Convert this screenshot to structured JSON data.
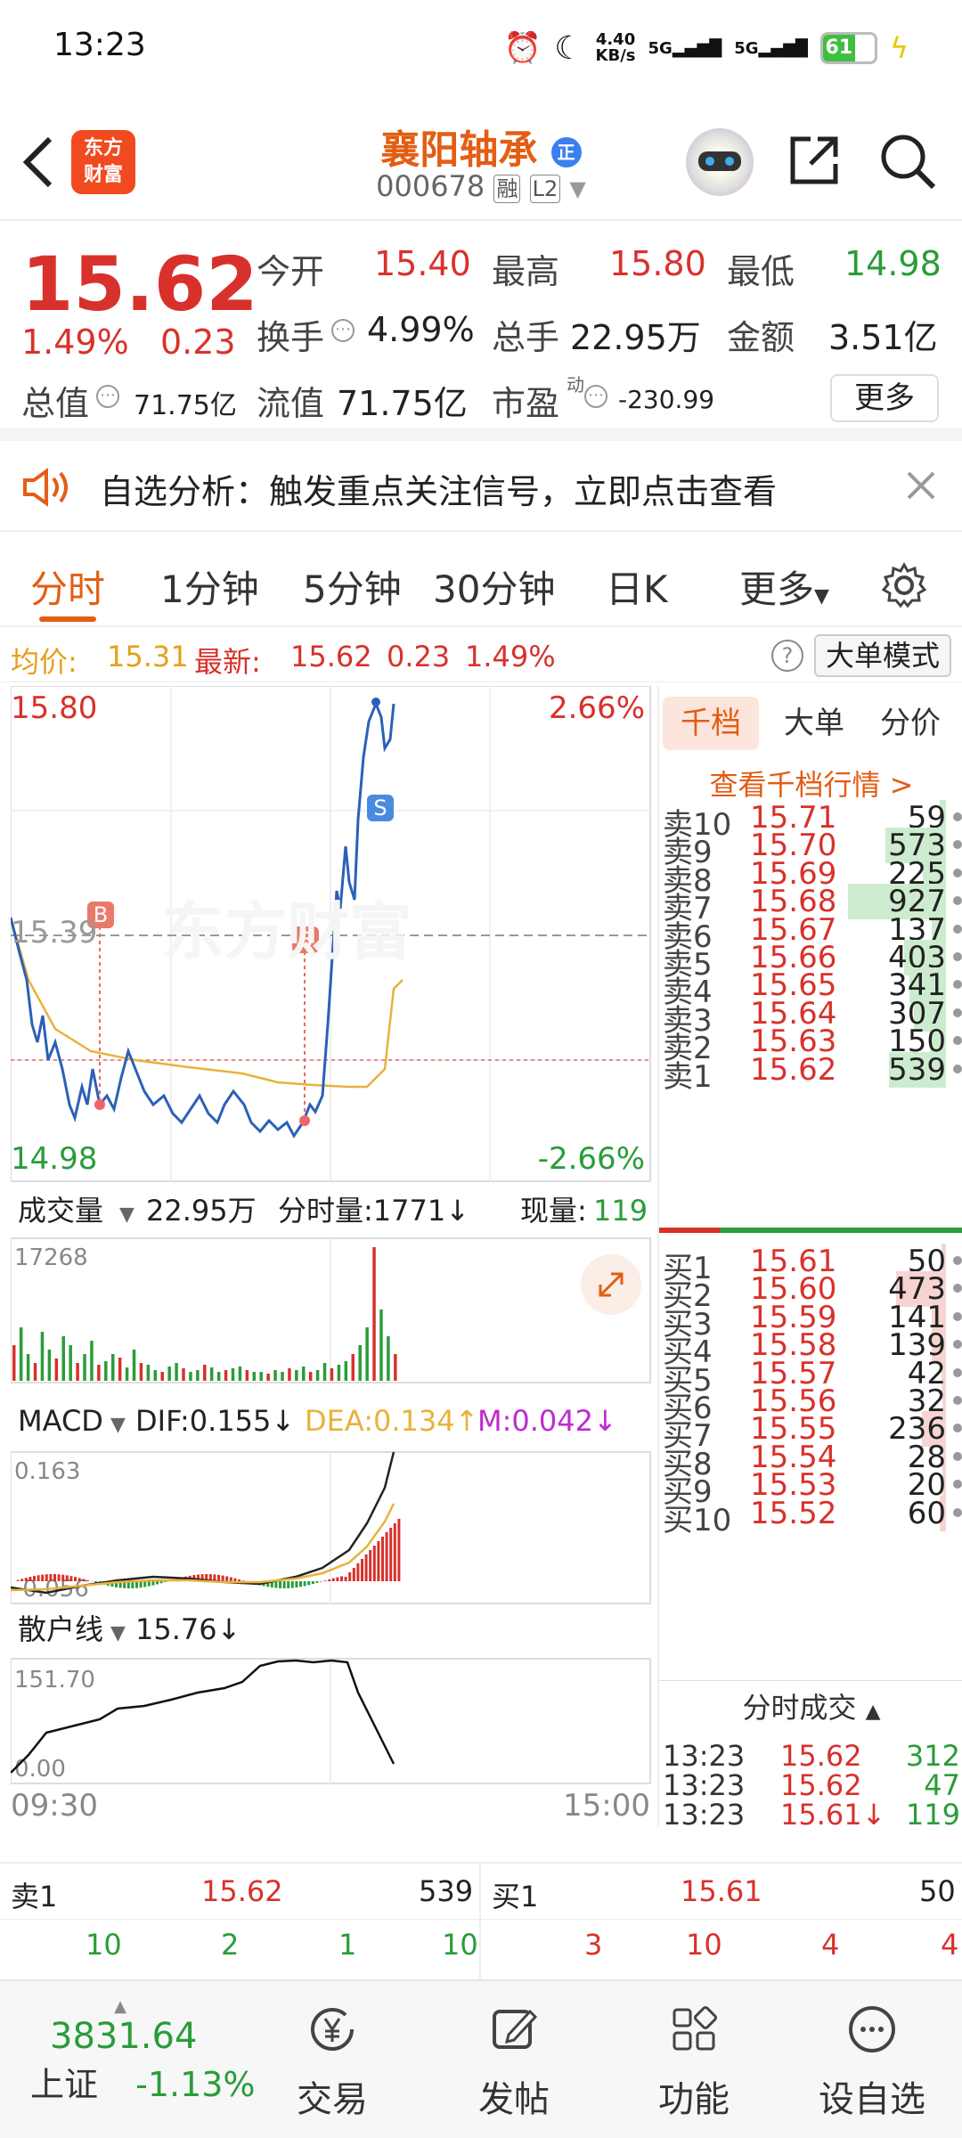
{
  "status": {
    "time": "13:23",
    "net_speed": "4.40",
    "net_unit": "KB/s",
    "sig1": "5G",
    "sig2": "5G",
    "battery": "61"
  },
  "header": {
    "logo_line1": "东方",
    "logo_line2": "财富",
    "title": "襄阳轴承",
    "code": "000678",
    "tag1": "融",
    "tag2": "L2",
    "badge": "正"
  },
  "quote": {
    "price": "15.62",
    "pct": "1.49%",
    "change": "0.23",
    "open_label": "今开",
    "open": "15.40",
    "high_label": "最高",
    "high": "15.80",
    "low_label": "最低",
    "low": "14.98",
    "turnover_label": "换手",
    "turnover": "4.99%",
    "volume_label": "总手",
    "volume": "22.95万",
    "amount_label": "金额",
    "amount": "3.51亿",
    "total_mv_label": "总值",
    "total_mv": "71.75亿",
    "float_mv_label": "流值",
    "float_mv": "71.75亿",
    "pe_label": "市盈",
    "pe_sup": "动",
    "pe": "-230.99",
    "more": "更多"
  },
  "notice": {
    "text": "自选分析：触发重点关注信号，立即点击查看"
  },
  "tabs": [
    "分时",
    "1分钟",
    "5分钟",
    "30分钟",
    "日K",
    "更多"
  ],
  "avgbar": {
    "avg_label": "均价:",
    "avg": "15.31",
    "latest_label": "最新:",
    "latest": "15.62",
    "chg": "0.23",
    "pct": "1.49%",
    "mode": "大单模式"
  },
  "chart": {
    "high": "15.80",
    "low": "14.98",
    "mid": "15.39",
    "up_pct": "2.66%",
    "down_pct": "-2.66%",
    "watermark": "东方财富",
    "start_time": "09:30",
    "end_time": "15:00",
    "vol_selector": "成交量",
    "vol_total": "22.95万",
    "tick_vol_label": "分时量:1771↓",
    "cur_vol_label": "现量:",
    "cur_vol": "119",
    "vol_max": "17268",
    "macd_selector": "MACD",
    "dif": "DIF:0.155↓",
    "dea": "DEA:0.134↑",
    "m": "M:0.042↓",
    "macd_max": "0.163",
    "macd_min": "-0.056",
    "retail_selector": "散户线",
    "retail_val": "15.76↓",
    "retail_max": "151.70",
    "retail_min": "0.00",
    "marker_b": "B",
    "marker_s": "S",
    "chart_data": {
      "type": "line",
      "y_range": [
        14.98,
        15.8
      ],
      "reference": 15.39,
      "x_range": [
        "09:30",
        "15:00"
      ]
    }
  },
  "side": {
    "tabs": [
      "千档",
      "大单",
      "分价"
    ],
    "link": "查看千档行情 >",
    "asks": [
      {
        "label": "卖10",
        "price": "15.71",
        "vol": "59",
        "bar": 0.06
      },
      {
        "label": "卖9",
        "price": "15.70",
        "vol": "573",
        "bar": 0.62
      },
      {
        "label": "卖8",
        "price": "15.69",
        "vol": "225",
        "bar": 0.24
      },
      {
        "label": "卖7",
        "price": "15.68",
        "vol": "927",
        "bar": 1.0
      },
      {
        "label": "卖6",
        "price": "15.67",
        "vol": "137",
        "bar": 0.15
      },
      {
        "label": "卖5",
        "price": "15.66",
        "vol": "403",
        "bar": 0.43
      },
      {
        "label": "卖4",
        "price": "15.65",
        "vol": "341",
        "bar": 0.37
      },
      {
        "label": "卖3",
        "price": "15.64",
        "vol": "307",
        "bar": 0.33
      },
      {
        "label": "卖2",
        "price": "15.63",
        "vol": "150",
        "bar": 0.16
      },
      {
        "label": "卖1",
        "price": "15.62",
        "vol": "539",
        "bar": 0.58
      }
    ],
    "bids": [
      {
        "label": "买1",
        "price": "15.61",
        "vol": "50",
        "bar": 0.05
      },
      {
        "label": "买2",
        "price": "15.60",
        "vol": "473",
        "bar": 0.51
      },
      {
        "label": "买3",
        "price": "15.59",
        "vol": "141",
        "bar": 0.15
      },
      {
        "label": "买4",
        "price": "15.58",
        "vol": "139",
        "bar": 0.15
      },
      {
        "label": "买5",
        "price": "15.57",
        "vol": "42",
        "bar": 0.05
      },
      {
        "label": "买6",
        "price": "15.56",
        "vol": "32",
        "bar": 0.03
      },
      {
        "label": "买7",
        "price": "15.55",
        "vol": "236",
        "bar": 0.25
      },
      {
        "label": "买8",
        "price": "15.54",
        "vol": "28",
        "bar": 0.03
      },
      {
        "label": "买9",
        "price": "15.53",
        "vol": "20",
        "bar": 0.02
      },
      {
        "label": "买10",
        "price": "15.52",
        "vol": "60",
        "bar": 0.06
      }
    ],
    "trades_title": "分时成交",
    "trades": [
      {
        "time": "13:23",
        "price": "15.62",
        "vol": "312"
      },
      {
        "time": "13:23",
        "price": "15.62",
        "vol": "47"
      },
      {
        "time": "13:23",
        "price": "15.61↓",
        "vol": "119"
      }
    ]
  },
  "bottom_quote": {
    "sell_label": "卖1",
    "sell_price": "15.62",
    "sell_vol": "539",
    "buy_label": "买1",
    "buy_price": "15.61",
    "buy_vol": "50",
    "sell_ticks": [
      "10",
      "2",
      "1",
      "10"
    ],
    "buy_ticks": [
      "3",
      "10",
      "4",
      "4"
    ]
  },
  "nav": {
    "index_value": "3831.64",
    "index_name": "上证",
    "index_pct": "-1.13%",
    "items": [
      "交易",
      "发帖",
      "功能",
      "设自选"
    ]
  }
}
